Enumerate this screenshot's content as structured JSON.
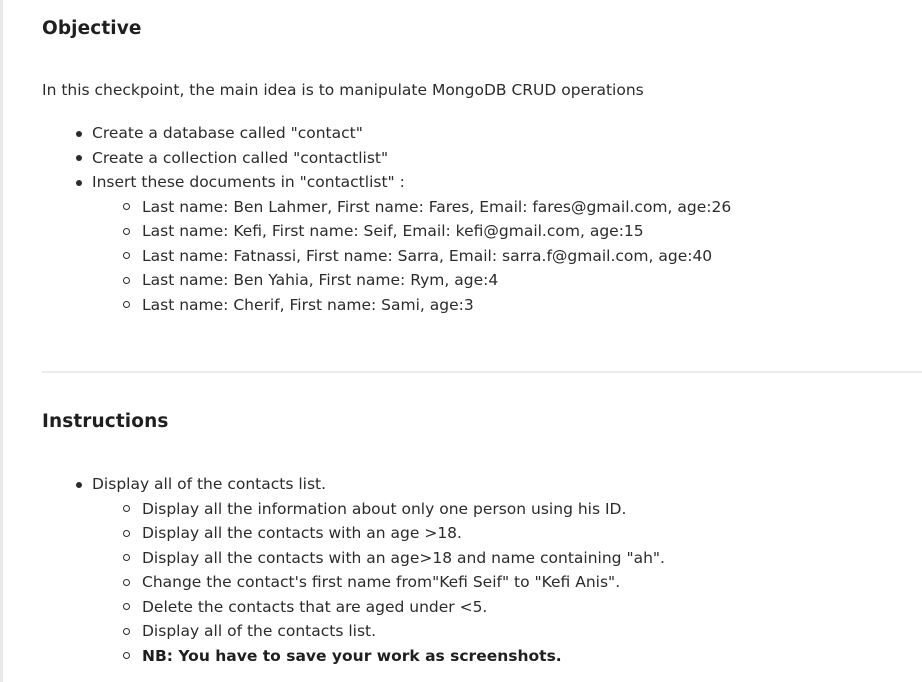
{
  "objective": {
    "title": "Objective",
    "intro": "In this checkpoint, the main idea is to manipulate MongoDB CRUD operations",
    "items": [
      "Create a database called \"contact\"",
      "Create a collection called \"contactlist\"",
      "Insert these documents  in \"contactlist\" :"
    ],
    "documents": [
      "Last name: Ben Lahmer, First name: Fares, Email: fares@gmail.com, age:26",
      "Last name: Kefi, First name: Seif, Email: kefi@gmail.com, age:15",
      "Last name: Fatnassi, First name: Sarra, Email: sarra.f@gmail.com, age:40",
      "Last name: Ben Yahia, First name: Rym, age:4",
      "Last name: Cherif, First name: Sami, age:3"
    ]
  },
  "instructions": {
    "title": "Instructions",
    "item": "Display all of the contacts list.",
    "subitems": [
      "Display all the information about only one person using his ID.",
      "Display all the contacts with an age >18.",
      "Display all the contacts with an age>18 and name containing \"ah\".",
      "Change the contact's first name from\"Kefi Seif\" to \"Kefi Anis\".",
      "Delete the contacts that are aged under <5.",
      "Display all of the contacts list."
    ],
    "note": "NB: You have to save your work as screenshots."
  }
}
